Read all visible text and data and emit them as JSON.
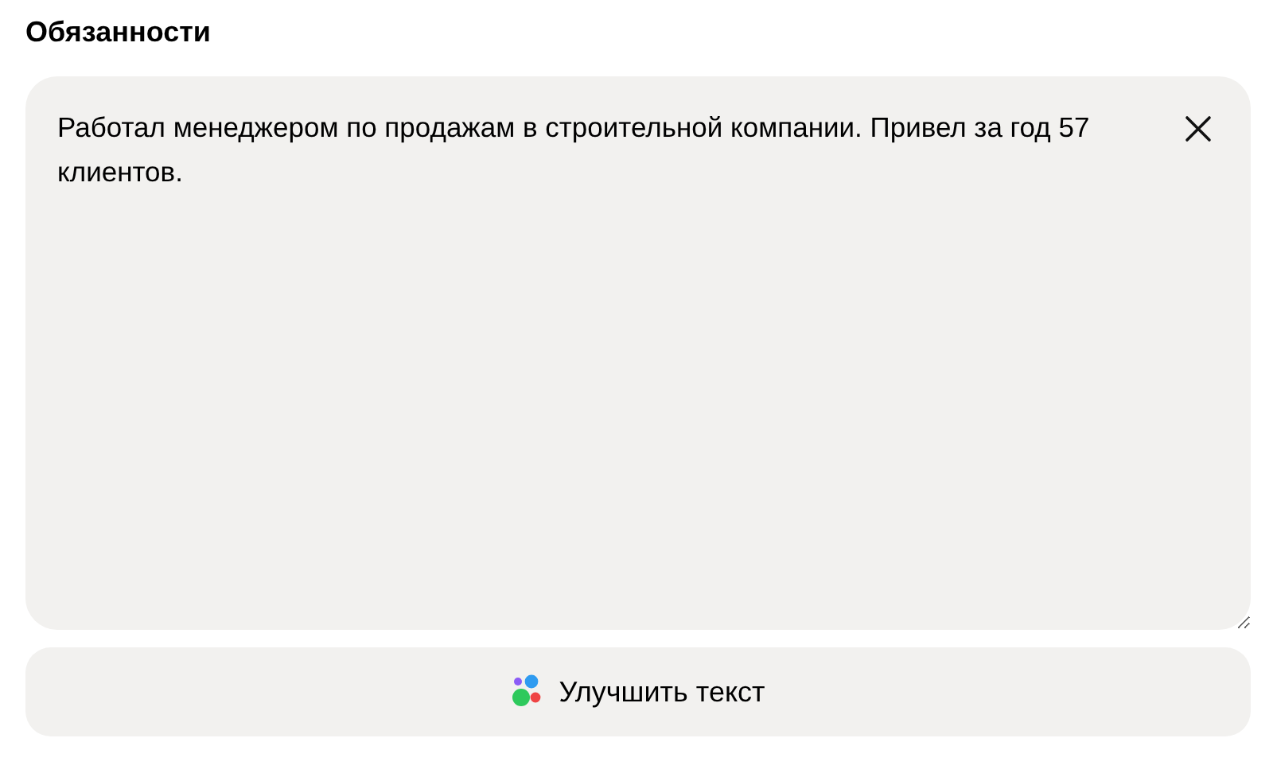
{
  "section_title": "Обязанности",
  "textarea": {
    "value": "Работал менеджером по продажам в строительной компании. Привел за год 57 клиентов."
  },
  "improve_button": {
    "label": "Улучшить текст"
  }
}
